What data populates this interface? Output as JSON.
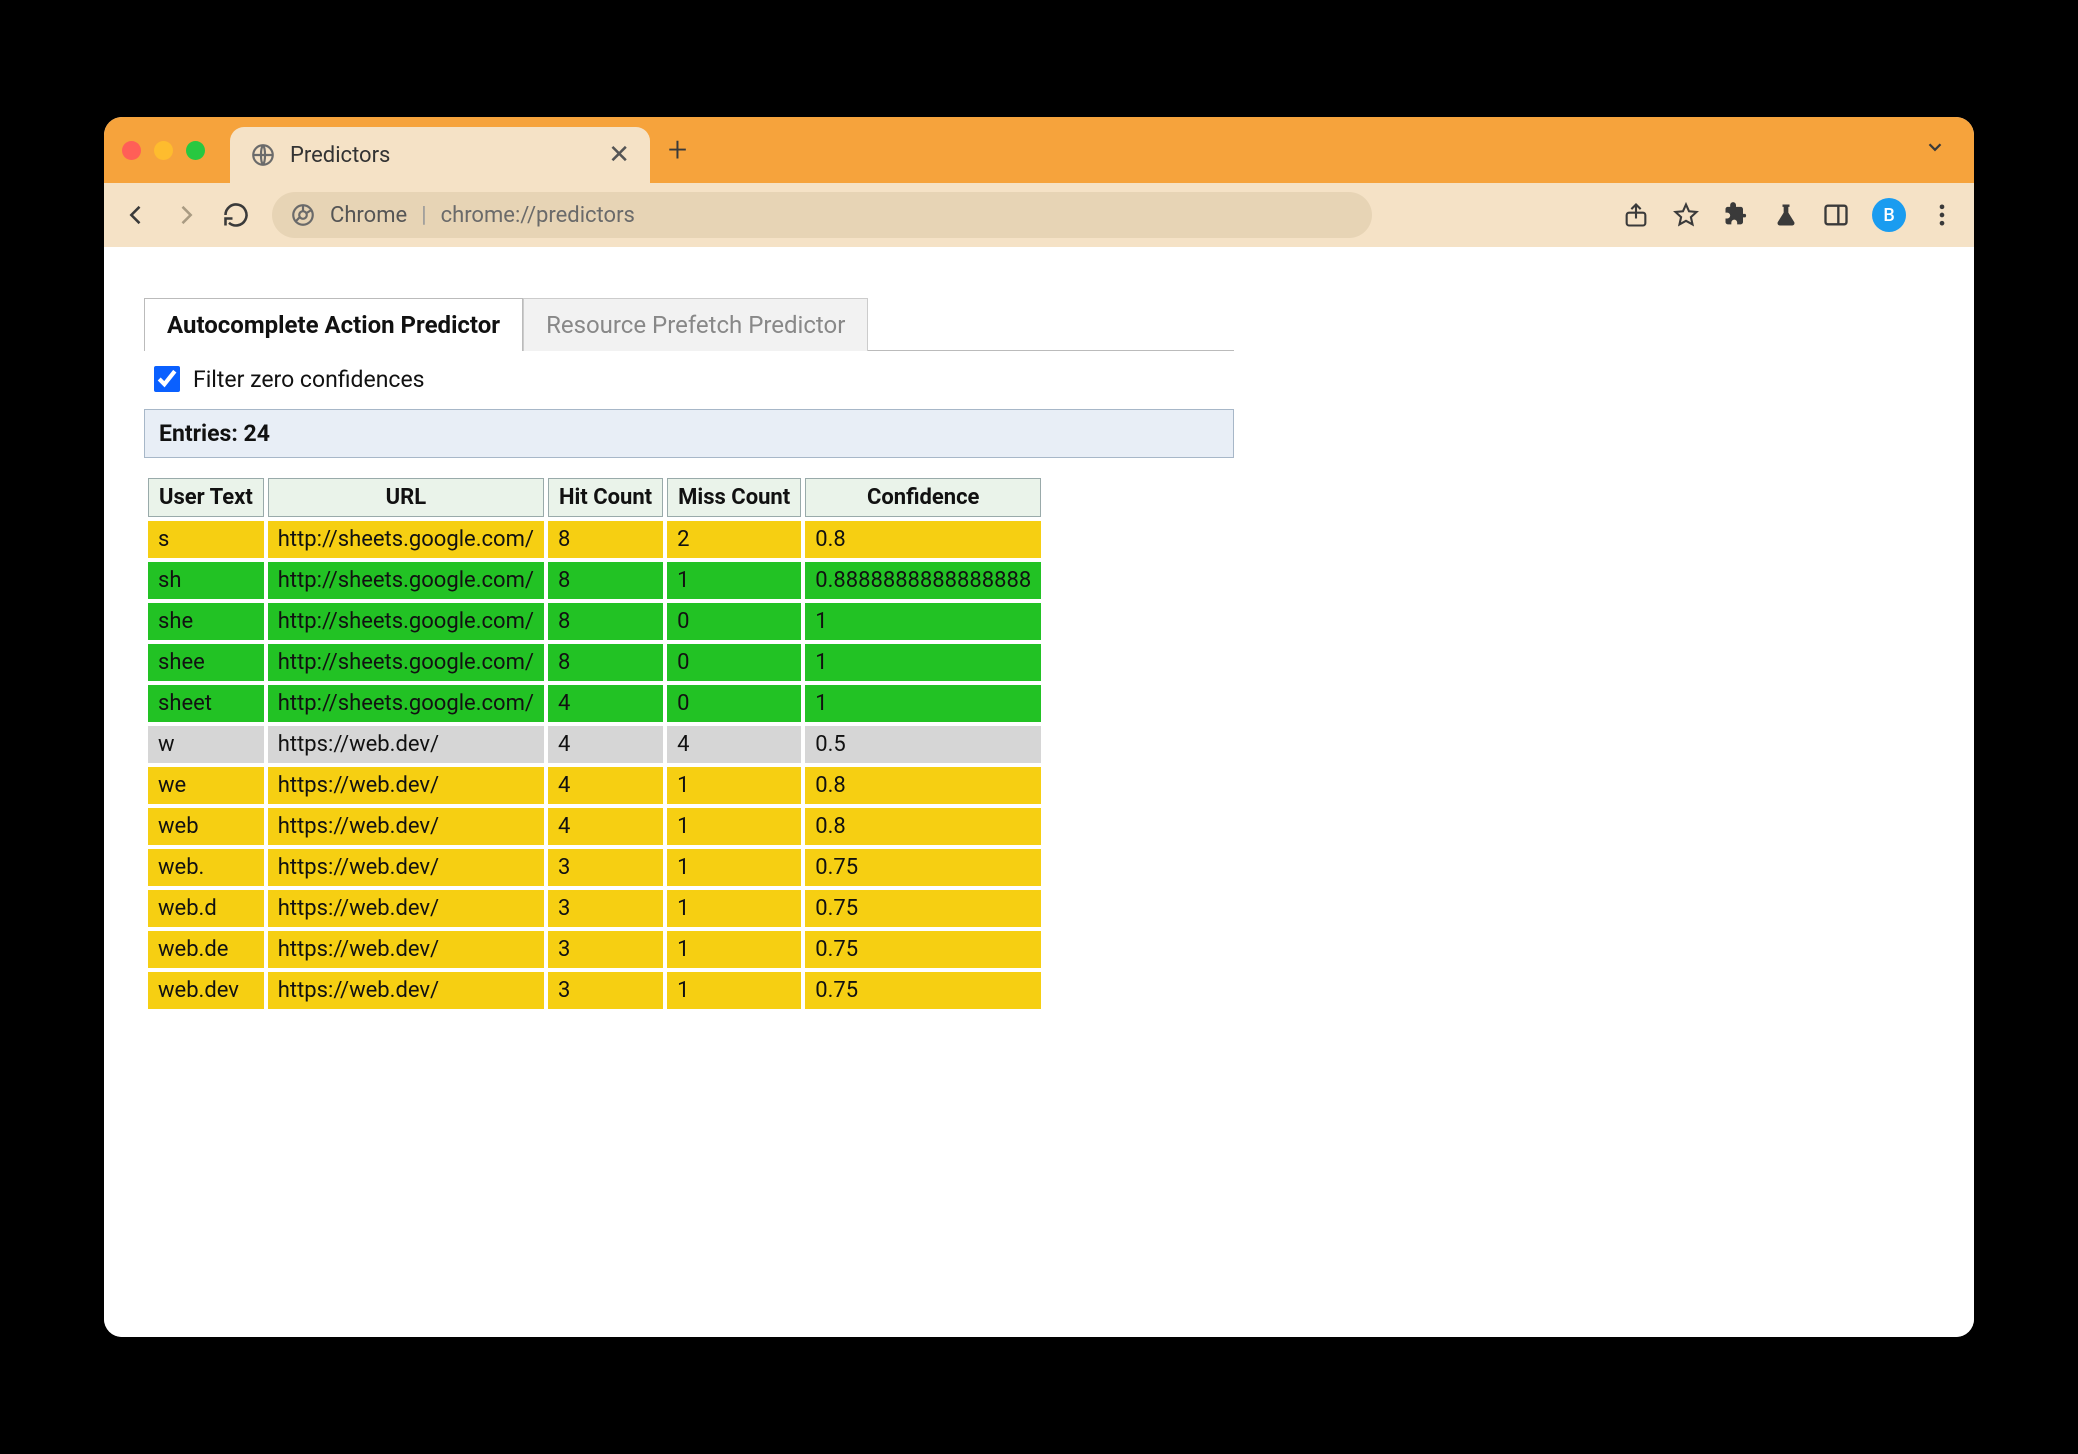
{
  "browser": {
    "tab_title": "Predictors",
    "omnibox_label": "Chrome",
    "omnibox_url": "chrome://predictors",
    "avatar_letter": "B"
  },
  "page": {
    "tabs": [
      {
        "label": "Autocomplete Action Predictor",
        "active": true
      },
      {
        "label": "Resource Prefetch Predictor",
        "active": false
      }
    ],
    "filter_label": "Filter zero confidences",
    "filter_checked": true,
    "entries_label": "Entries: 24",
    "columns": [
      "User Text",
      "URL",
      "Hit Count",
      "Miss Count",
      "Confidence"
    ],
    "rows": [
      {
        "user_text": "s",
        "url": "http://sheets.google.com/",
        "hit": "8",
        "miss": "2",
        "conf": "0.8",
        "tone": "yellow"
      },
      {
        "user_text": "sh",
        "url": "http://sheets.google.com/",
        "hit": "8",
        "miss": "1",
        "conf": "0.8888888888888888",
        "tone": "green"
      },
      {
        "user_text": "she",
        "url": "http://sheets.google.com/",
        "hit": "8",
        "miss": "0",
        "conf": "1",
        "tone": "green"
      },
      {
        "user_text": "shee",
        "url": "http://sheets.google.com/",
        "hit": "8",
        "miss": "0",
        "conf": "1",
        "tone": "green"
      },
      {
        "user_text": "sheet",
        "url": "http://sheets.google.com/",
        "hit": "4",
        "miss": "0",
        "conf": "1",
        "tone": "green"
      },
      {
        "user_text": "w",
        "url": "https://web.dev/",
        "hit": "4",
        "miss": "4",
        "conf": "0.5",
        "tone": "grey"
      },
      {
        "user_text": "we",
        "url": "https://web.dev/",
        "hit": "4",
        "miss": "1",
        "conf": "0.8",
        "tone": "yellow"
      },
      {
        "user_text": "web",
        "url": "https://web.dev/",
        "hit": "4",
        "miss": "1",
        "conf": "0.8",
        "tone": "yellow"
      },
      {
        "user_text": "web.",
        "url": "https://web.dev/",
        "hit": "3",
        "miss": "1",
        "conf": "0.75",
        "tone": "yellow"
      },
      {
        "user_text": "web.d",
        "url": "https://web.dev/",
        "hit": "3",
        "miss": "1",
        "conf": "0.75",
        "tone": "yellow"
      },
      {
        "user_text": "web.de",
        "url": "https://web.dev/",
        "hit": "3",
        "miss": "1",
        "conf": "0.75",
        "tone": "yellow"
      },
      {
        "user_text": "web.dev",
        "url": "https://web.dev/",
        "hit": "3",
        "miss": "1",
        "conf": "0.75",
        "tone": "yellow"
      }
    ]
  }
}
